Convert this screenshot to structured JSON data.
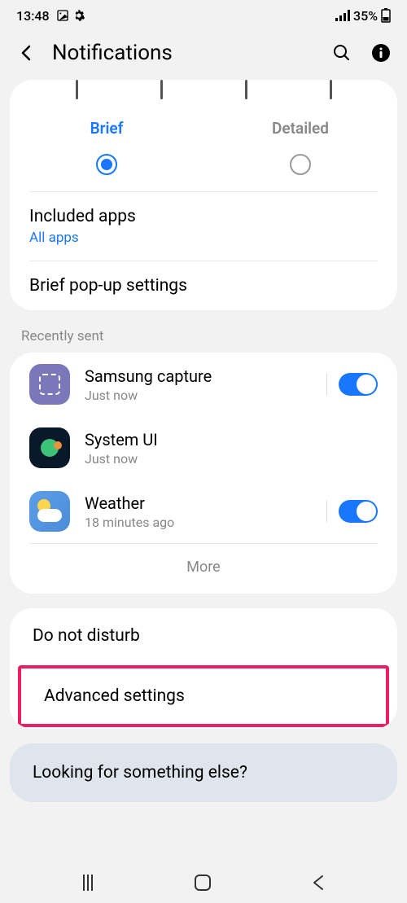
{
  "status": {
    "time": "13:48",
    "battery": "35%"
  },
  "header": {
    "title": "Notifications"
  },
  "styleSelector": {
    "brief": "Brief",
    "detailed": "Detailed"
  },
  "includedApps": {
    "title": "Included apps",
    "subtitle": "All apps"
  },
  "briefPopup": {
    "title": "Brief pop-up settings"
  },
  "recentlySent": {
    "header": "Recently sent",
    "apps": [
      {
        "name": "Samsung capture",
        "time": "Just now"
      },
      {
        "name": "System UI",
        "time": "Just now"
      },
      {
        "name": "Weather",
        "time": "18 minutes ago"
      }
    ],
    "more": "More"
  },
  "doNotDisturb": "Do not disturb",
  "advancedSettings": "Advanced settings",
  "lookingFor": "Looking for something else?"
}
